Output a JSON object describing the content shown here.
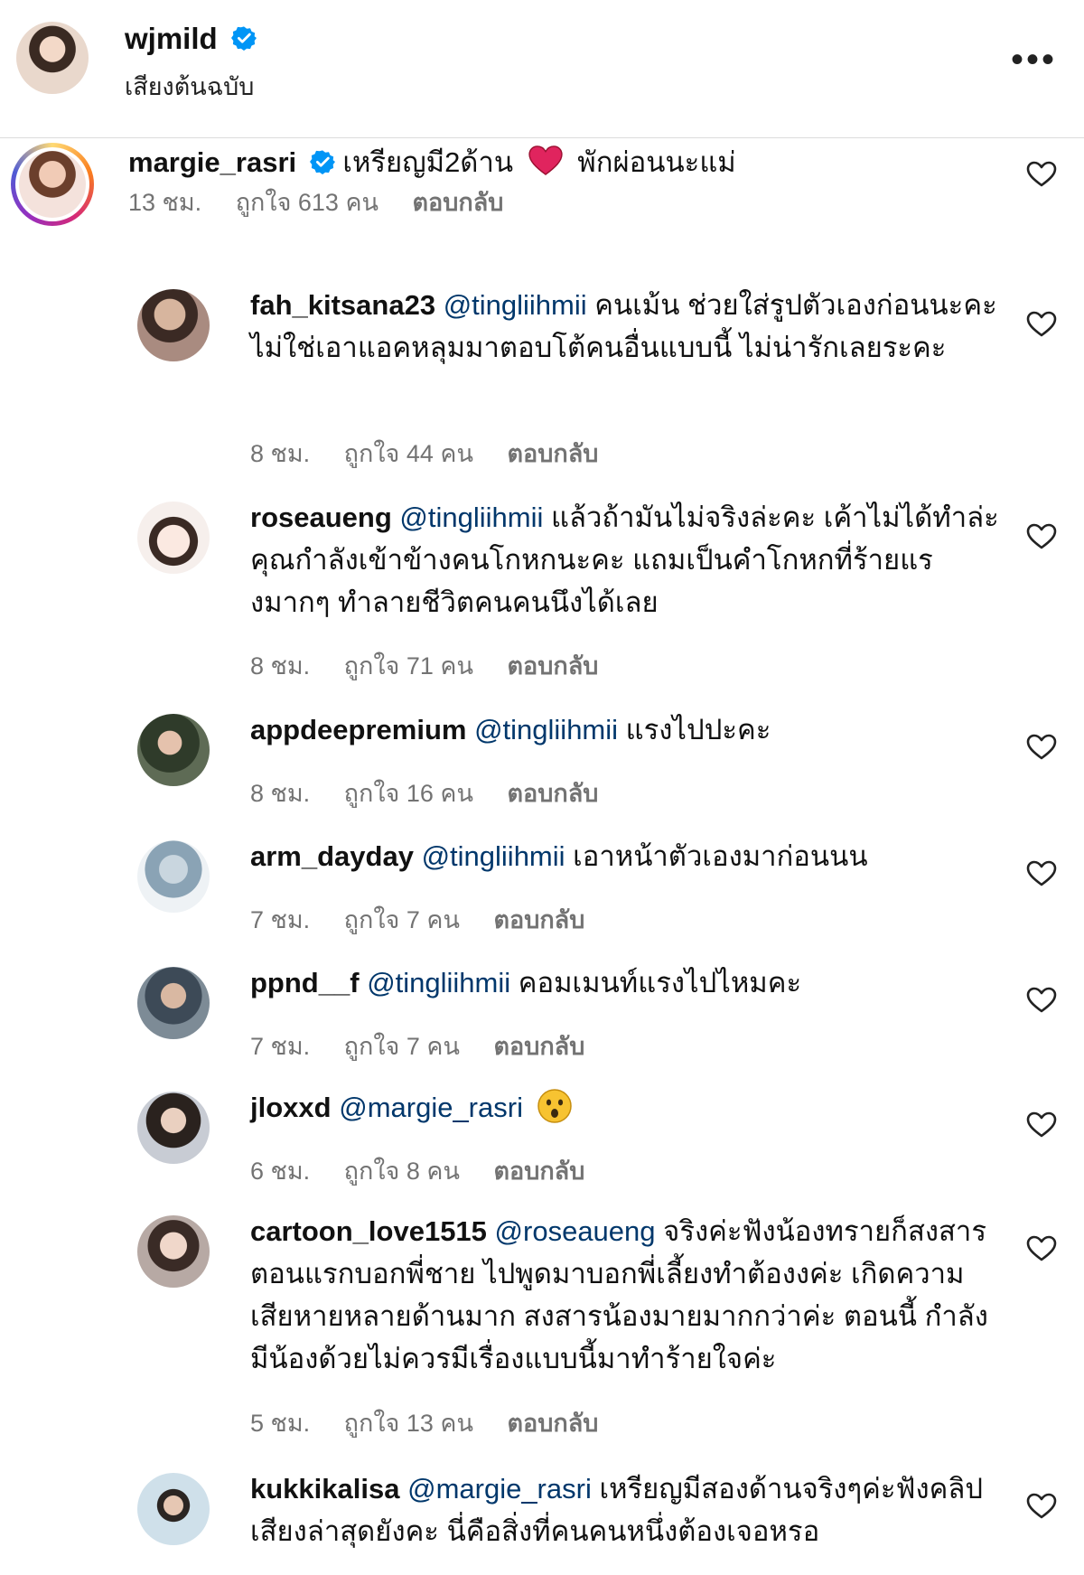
{
  "header": {
    "username": "wjmild",
    "subtitle": "เสียงต้นฉบับ",
    "more_label": "•••"
  },
  "top_comment": {
    "username": "margie_rasri",
    "text_before": "เหรียญมี2ด้าน",
    "text_after": "พักผ่อนนะแม่",
    "time": "13 ชม.",
    "likes": "ถูกใจ 613 คน",
    "reply": "ตอบกลับ"
  },
  "replies": [
    {
      "username": "fah_kitsana23",
      "mention": "@tingliihmii",
      "text": "คนเม้น ช่วยใส่รูปตัวเองก่อนนะคะ ไม่ใช่เอาแอคหลุมมาตอบโต้คนอื่นแบบนี้ ไม่น่ารักเลยระคะ",
      "time": "8 ชม.",
      "likes": "ถูกใจ 44 คน",
      "reply": "ตอบกลับ"
    },
    {
      "username": "roseaueng",
      "mention": "@tingliihmii",
      "text": "แล้วถ้ามันไม่จริงล่ะคะ เค้าไม่ได้ทำล่ะ คุณกำลังเข้าข้างคนโกหกนะคะ แถมเป็นคำโกหกที่ร้ายแรงมากๆ ทำลายชีวิตคนคนนึงได้เลย",
      "time": "8 ชม.",
      "likes": "ถูกใจ 71 คน",
      "reply": "ตอบกลับ"
    },
    {
      "username": "appdeepremium",
      "mention": "@tingliihmii",
      "text": "แรงไปปะคะ",
      "time": "8 ชม.",
      "likes": "ถูกใจ 16 คน",
      "reply": "ตอบกลับ"
    },
    {
      "username": "arm_dayday",
      "mention": "@tingliihmii",
      "text": "เอาหน้าตัวเองมาก่อนนน",
      "time": "7 ชม.",
      "likes": "ถูกใจ 7 คน",
      "reply": "ตอบกลับ"
    },
    {
      "username": "ppnd__f",
      "mention": "@tingliihmii",
      "text": "คอมเมนท์แรงไปไหมคะ",
      "time": "7 ชม.",
      "likes": "ถูกใจ 7 คน",
      "reply": "ตอบกลับ"
    },
    {
      "username": "jloxxd",
      "mention": "@margie_rasri",
      "text": "",
      "time": "6 ชม.",
      "likes": "ถูกใจ 8 คน",
      "reply": "ตอบกลับ"
    },
    {
      "username": "cartoon_love1515",
      "mention": "@roseaueng",
      "text": "จริงค่ะฟังน้องทรายก็สงสาร ตอนแรกบอกพี่ชาย ไปพูดมาบอกพี่เลี้ยงทำต้องงค่ะ เกิดความเสียหายหลายด้านมาก สงสารน้องมายมากกว่าค่ะ ตอนนี้ กำลังมีน้องด้วยไม่ควรมีเรื่องแบบนี้มาทำร้ายใจค่ะ",
      "time": "5 ชม.",
      "likes": "ถูกใจ 13 คน",
      "reply": "ตอบกลับ"
    },
    {
      "username": "kukkikalisa",
      "mention": "@margie_rasri",
      "text": "เหรียญมีสองด้านจริงๆค่ะฟังคลิปเสียงล่าสุดยังคะ นี่คือสิ่งที่คนคนหนึ่งต้องเจอหรอ",
      "time": "",
      "likes": "",
      "reply": ""
    }
  ],
  "icons": {
    "verified": "verified-badge-icon",
    "heart": "heart-outline-icon",
    "more": "more-options-icon",
    "red_heart": "red-heart-emoji",
    "wow": "astonished-face-emoji"
  },
  "colors": {
    "verified": "#0095f6",
    "mention": "#00376b",
    "meta": "#737373",
    "red_heart": "#e0245e"
  }
}
